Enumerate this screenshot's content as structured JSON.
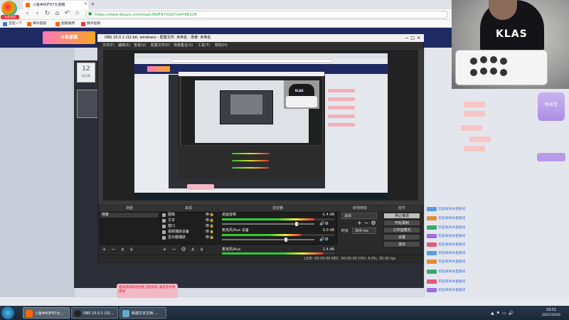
{
  "browser": {
    "logo_label": "云朵浏览",
    "active_tab": "斗鱼#KOF97大道鳞",
    "address": "https://www.douyu.com/topic/KOF97XGS?rid=96226",
    "bookmarks": [
      "百度一下",
      "精华超链",
      "国服推荐",
      "精华超链"
    ]
  },
  "douyu": {
    "room_number": "12",
    "room_sub": "粉丝数",
    "logo": "斗鱼直播",
    "promo": "相关游戏体验优惠 已经组队 满足条件免费领",
    "chat": [
      {
        "badge_color": "#5a9be0",
        "name": "欢迎来到本直播间"
      },
      {
        "badge_color": "#e38b3a",
        "name": "欢迎来到本直播间"
      },
      {
        "badge_color": "#3aa86b",
        "name": "欢迎来到本直播间"
      },
      {
        "badge_color": "#9b6be0",
        "name": "欢迎来到本直播间"
      },
      {
        "badge_color": "#e05a7a",
        "name": "欢迎来到本直播间"
      },
      {
        "badge_color": "#5a9be0",
        "name": "欢迎来到本直播间"
      },
      {
        "badge_color": "#e38b3a",
        "name": "欢迎来到本直播间"
      },
      {
        "badge_color": "#3aa86b",
        "name": "欢迎来到本直播间"
      },
      {
        "badge_color": "#e05a7a",
        "name": "欢迎来到本直播间"
      },
      {
        "badge_color": "#9b6be0",
        "name": "欢迎来到本直播间"
      }
    ],
    "right_badge": "粉丝宝"
  },
  "webcam": {
    "shirt_text": "KLAS"
  },
  "obs": {
    "title": "OBS 25.0.1 (32-bit, windows) - 配置文件: 未命名 - 场景: 未命名",
    "menu": [
      "文件(F)",
      "编辑(E)",
      "查看(V)",
      "配置文件(P)",
      "场景集合(S)",
      "工具(T)",
      "帮助(H)"
    ],
    "dock_titles": {
      "scenes": "场景",
      "sources": "来源",
      "mixer": "混音器",
      "transitions": "转场特效",
      "controls": "控件"
    },
    "scenes": [
      "场景"
    ],
    "sources": [
      "图像",
      "文本",
      "窗口",
      "视频捕获设备",
      "显示器捕获"
    ],
    "mixer": [
      {
        "label": "桌面音频",
        "db": "-1.4 dB",
        "level": 0.82
      },
      {
        "label": "麦克风/Aux 设备",
        "db": "0.0 dB",
        "level": 0.7
      },
      {
        "label": "麦克风/Aux",
        "db": "1.4 dB",
        "level": 0.9
      }
    ],
    "transition": "淡出",
    "duration_label": "时长",
    "duration": "300 ms",
    "controls": [
      "停止推流",
      "开始录制",
      "工作室模式",
      "设置",
      "退出"
    ],
    "status": "LIVE: 00:00:00    REC: 00:00:00    CPU: 4.0%, 30.00 fps"
  },
  "taskbar": {
    "items": [
      "斗鱼#KOF97大...",
      "OBS 25.0.1 (32...",
      "新建文本文档 ..."
    ],
    "time": "19:51",
    "date": "2021/10/16"
  }
}
